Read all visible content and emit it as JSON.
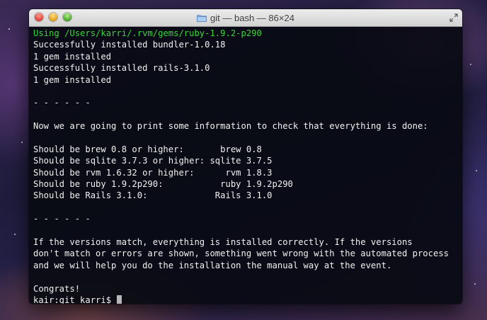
{
  "window": {
    "title": "git — bash — 86×24"
  },
  "terminal": {
    "lines": [
      {
        "text": "Using /Users/karri/.rvm/gems/ruby-1.9.2-p290",
        "color": "#3bd43b"
      },
      {
        "text": "Successfully installed bundler-1.0.18"
      },
      {
        "text": "1 gem installed"
      },
      {
        "text": "Successfully installed rails-3.1.0"
      },
      {
        "text": "1 gem installed"
      },
      {
        "text": ""
      },
      {
        "text": "- - - - - -"
      },
      {
        "text": ""
      },
      {
        "text": "Now we are going to print some information to check that everything is done:"
      },
      {
        "text": ""
      },
      {
        "text": "Should be brew 0.8 or higher:       brew 0.8"
      },
      {
        "text": "Should be sqlite 3.7.3 or higher: sqlite 3.7.5"
      },
      {
        "text": "Should be rvm 1.6.32 or higher:      rvm 1.8.3"
      },
      {
        "text": "Should be ruby 1.9.2p290:           ruby 1.9.2p290"
      },
      {
        "text": "Should be Rails 3.1.0:             Rails 3.1.0"
      },
      {
        "text": ""
      },
      {
        "text": "- - - - - -"
      },
      {
        "text": ""
      },
      {
        "text": "If the versions match, everything is installed correctly. If the versions"
      },
      {
        "text": "don't match or errors are shown, something went wrong with the automated process"
      },
      {
        "text": "and we will help you do the installation the manual way at the event."
      },
      {
        "text": ""
      },
      {
        "text": "Congrats!"
      }
    ],
    "prompt": "kair:git karri$ "
  },
  "icons": {
    "close": "close-button",
    "minimize": "minimize-button",
    "zoom": "zoom-button",
    "folder": "folder-icon",
    "fullscreen": "fullscreen-icon"
  },
  "colors": {
    "terminal_bg": "#0a0c14",
    "text": "#f2f2f2",
    "accent_green": "#3bd43b",
    "cursor": "#b8b8b8"
  }
}
